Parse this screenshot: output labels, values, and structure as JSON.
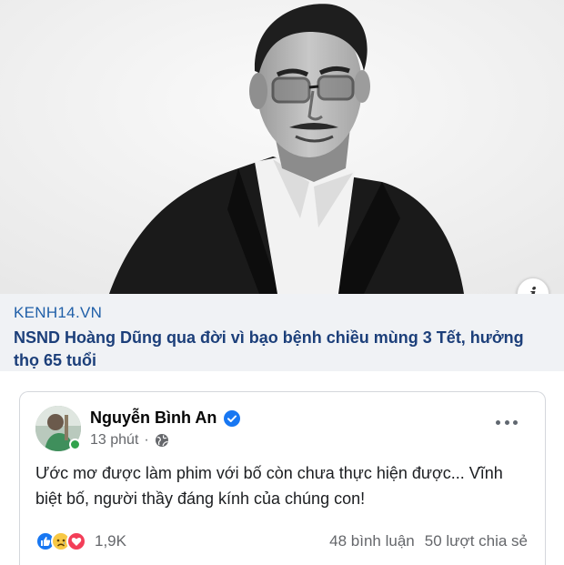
{
  "link_preview": {
    "domain": "KENH14.VN",
    "headline": "NSND Hoàng Dũng qua đời vì bạo bệnh chiều mùng 3 Tết, hưởng thọ 65 tuổi",
    "info_glyph": "i"
  },
  "post": {
    "author": "Nguyễn Bình An",
    "verified": true,
    "time": "13 phút",
    "separator": "·",
    "audience_icon": "globe-icon",
    "text": "Ước mơ được làm phim với bố còn chưa thực hiện được... Vĩnh biệt bố, người thầy đáng kính của chúng con!",
    "reactions": [
      "like-icon",
      "sad-icon",
      "love-icon"
    ],
    "reaction_count": "1,9K",
    "comments": "48 bình luận",
    "shares": "50 lượt chia sẻ"
  },
  "colors": {
    "link_domain": "#1f5fa8",
    "link_headline": "#1c3f7a",
    "link_bg": "#f0f2f5",
    "meta_text": "#65676b",
    "verified_blue": "#1877f2",
    "online_green": "#31a24c"
  }
}
